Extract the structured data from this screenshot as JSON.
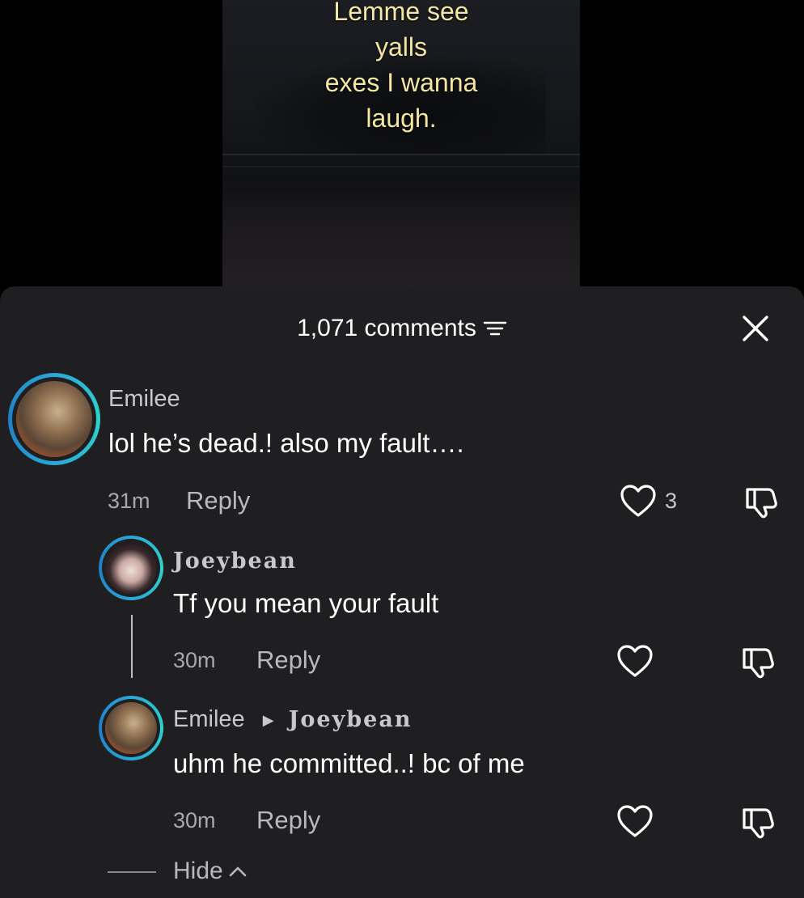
{
  "video": {
    "caption_lines": [
      "Lemme see",
      "yalls",
      "exes I wanna",
      "laugh."
    ]
  },
  "sheet": {
    "comment_count": "1,071 comments"
  },
  "comments": [
    {
      "author": "Emilee",
      "text": "lol he’s dead.! also my fault….",
      "time": "31m",
      "reply_label": "Reply",
      "likes": "3"
    }
  ],
  "replies": [
    {
      "author": "Joeybean",
      "text": "Tf you mean your fault",
      "time": "30m",
      "reply_label": "Reply"
    },
    {
      "author": "Emilee",
      "reply_to": "Joeybean",
      "text": "uhm he committed..! bc of me",
      "time": "30m",
      "reply_label": "Reply"
    }
  ],
  "hide_label": "Hide",
  "colors": {
    "sheet_bg": "#1f1f21",
    "caption": "#f3e7a3",
    "avatar_ring": "#2fd3c9"
  },
  "icons": {
    "filter": "filter-icon",
    "close": "close-icon",
    "like": "heart-icon",
    "dislike": "thumbs-down-icon",
    "hide": "chevron-up-icon"
  }
}
